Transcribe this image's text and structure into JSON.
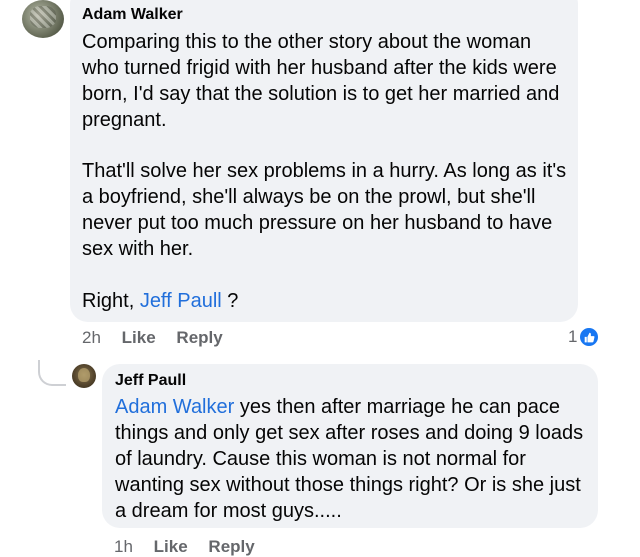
{
  "comment": {
    "author": "Adam Walker",
    "paragraph1": "Comparing this to the other story about the woman who turned frigid with her husband after the kids were born, I'd say that the solution is to get her married and pregnant.",
    "paragraph2": "That'll solve her sex problems in a hurry. As long as it's a boyfriend, she'll always be on the prowl, but she'll never put too much pressure on her husband to have sex with her.",
    "paragraph3_prefix": "Right, ",
    "paragraph3_mention": "Jeff Paull",
    "paragraph3_suffix": " ?",
    "time": "2h",
    "like_label": "Like",
    "reply_label": "Reply",
    "reaction_count": "1",
    "reaction_icon": "thumbs-up-icon"
  },
  "reply": {
    "author": "Jeff Paull",
    "mention": "Adam Walker",
    "text": " yes then after marriage he can pace things and only get sex after roses and doing 9 loads of laundry.  Cause this woman is not normal for wanting sex without those things right?  Or is she just a dream for most guys.....",
    "time": "1h",
    "like_label": "Like",
    "reply_label": "Reply"
  },
  "colors": {
    "bubble": "#f0f2f5",
    "mention": "#216fdb",
    "meta": "#65676b",
    "like_blue": "#1877f2"
  }
}
